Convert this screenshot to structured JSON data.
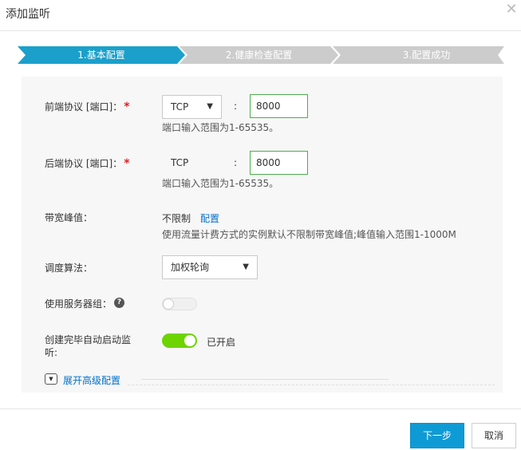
{
  "dialog": {
    "title": "添加监听",
    "close_glyph": "✕"
  },
  "steps": [
    {
      "label": "1.基本配置",
      "state": "active",
      "color": "#1aa0cb"
    },
    {
      "label": "2.健康检查配置",
      "state": "pending",
      "color": "#cccccc"
    },
    {
      "label": "3.配置成功",
      "state": "pending",
      "color": "#cccccc"
    }
  ],
  "form": {
    "frontend": {
      "label": "前端协议 [端口]：",
      "required_mark": "*",
      "protocol": "TCP",
      "colon": ":",
      "port": "8000",
      "hint": "端口输入范围为1-65535。"
    },
    "backend": {
      "label": "后端协议 [端口]：",
      "required_mark": "*",
      "protocol": "TCP",
      "colon": ":",
      "port": "8000",
      "hint": "端口输入范围为1-65535。"
    },
    "bandwidth": {
      "label": "带宽峰值：",
      "value": "不限制",
      "config_link": "配置",
      "hint": "使用流量计费方式的实例默认不限制带宽峰值;峰值输入范围1-1000M"
    },
    "scheduler": {
      "label": "调度算法：",
      "value": "加权轮询"
    },
    "server_group": {
      "label": "使用服务器组：",
      "help_glyph": "?",
      "enabled": false
    },
    "auto_start": {
      "label_line1": "创建完毕自动启动监",
      "label_line2": "听:",
      "enabled": true,
      "status_text": "已开启"
    },
    "advanced": {
      "label": "展开高级配置"
    }
  },
  "footer": {
    "next_label": "下一步",
    "cancel_label": "取消"
  }
}
